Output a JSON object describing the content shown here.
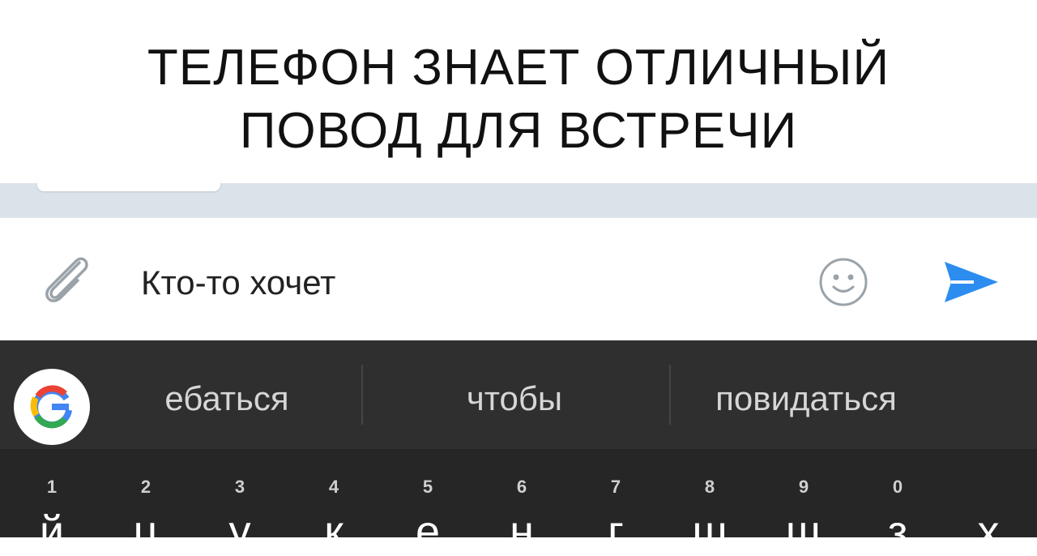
{
  "caption": {
    "line1": "ТЕЛЕФОН ЗНАЕТ ОТЛИЧНЫЙ",
    "line2": "ПОВОД ДЛЯ ВСТРЕЧИ"
  },
  "composer": {
    "message_text": "Кто-то хочет",
    "attach_icon": "paperclip-icon",
    "emoji_icon": "smiley-icon",
    "send_icon": "send-arrow-icon"
  },
  "suggestions": {
    "logo_icon": "google-g-icon",
    "items": [
      "ебаться",
      "чтобы",
      "повидаться"
    ]
  },
  "keyboard": {
    "keys": [
      {
        "num": "1",
        "letter": "й"
      },
      {
        "num": "2",
        "letter": "ц"
      },
      {
        "num": "3",
        "letter": "у"
      },
      {
        "num": "4",
        "letter": "к"
      },
      {
        "num": "5",
        "letter": "е"
      },
      {
        "num": "6",
        "letter": "н"
      },
      {
        "num": "7",
        "letter": "г"
      },
      {
        "num": "8",
        "letter": "ш"
      },
      {
        "num": "9",
        "letter": "щ"
      },
      {
        "num": "0",
        "letter": "з"
      },
      {
        "num": "",
        "letter": "х"
      }
    ]
  },
  "colors": {
    "accent_blue": "#2d8cf0",
    "suggestion_bar": "#2f2f2f",
    "keyboard_bg": "#262626"
  }
}
